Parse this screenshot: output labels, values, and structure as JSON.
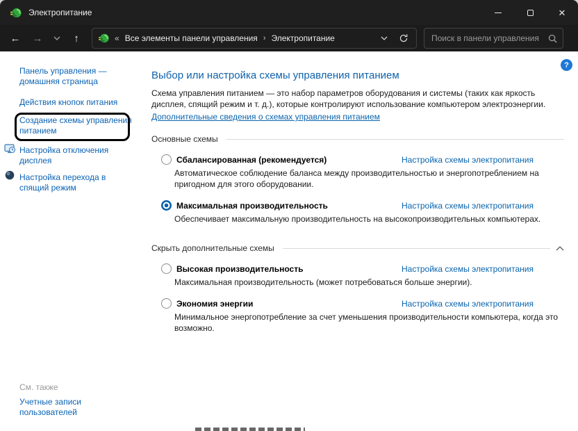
{
  "window": {
    "title": "Электропитание"
  },
  "icons": {
    "app": "power-options-green-battery",
    "back": "←",
    "forward": "→",
    "recent_pages": "⌄",
    "up": "↑",
    "breadcrumb_overflow": "«",
    "breadcrumb_separator": "›",
    "address_dropdown": "⌄",
    "refresh": "↻",
    "search": "magnifier",
    "help": "?",
    "collapse": "^",
    "minimize": "–",
    "maximize": "□",
    "close": "✕"
  },
  "nav": {
    "breadcrumb": {
      "items": [
        "Все элементы панели управления",
        "Электропитание"
      ]
    },
    "search": {
      "placeholder": "Поиск в панели управления"
    }
  },
  "sidebar": {
    "items": [
      "Панель управления —\nдомашняя страница",
      "Действия кнопок питания",
      "Создание схемы управления\nпитанием",
      "Настройка отключения\nдисплея",
      "Настройка перехода в\nспящий режим"
    ],
    "see_also": "См. также",
    "footer_link": "Учетные записи\nпользователей"
  },
  "main": {
    "title": "Выбор или настройка схемы управления питанием",
    "intro": "Схема управления питанием — это набор параметров оборудования и системы (таких как яркость дисплея, спящий режим и т. д.), которые контролируют использование компьютером электроэнергии.",
    "learn_more": "Дополнительные сведения о схемах управления питанием",
    "sections": {
      "main": "Основные схемы",
      "additional": "Скрыть дополнительные схемы"
    },
    "plans": [
      {
        "name": "Сбалансированная (рекомендуется)",
        "selected": false,
        "link": "Настройка схемы электропитания",
        "desc": "Автоматическое соблюдение баланса между производительностью и энергопотреблением на пригодном для этого оборудовании."
      },
      {
        "name": "Максимальная производительность",
        "selected": true,
        "link": "Настройка схемы электропитания",
        "desc": "Обеспечивает максимальную производительность на высокопроизводительных компьютерах."
      },
      {
        "name": "Высокая производительность",
        "selected": false,
        "link": "Настройка схемы электропитания",
        "desc": "Максимальная производительность (может потребоваться больше энергии)."
      },
      {
        "name": "Экономия энергии",
        "selected": false,
        "link": "Настройка схемы электропитания",
        "desc": "Минимальное энергопотребление за счет уменьшения производительности компьютера, когда это возможно."
      }
    ]
  },
  "colors": {
    "titlebar_bg": "#1f1f1f",
    "navbar_bg": "#1b1b1b",
    "link_blue": "#0b63b4",
    "header_blue": "#0f62ac",
    "radio_selected": "#0b62ad",
    "help_blue": "#1e78d7"
  }
}
